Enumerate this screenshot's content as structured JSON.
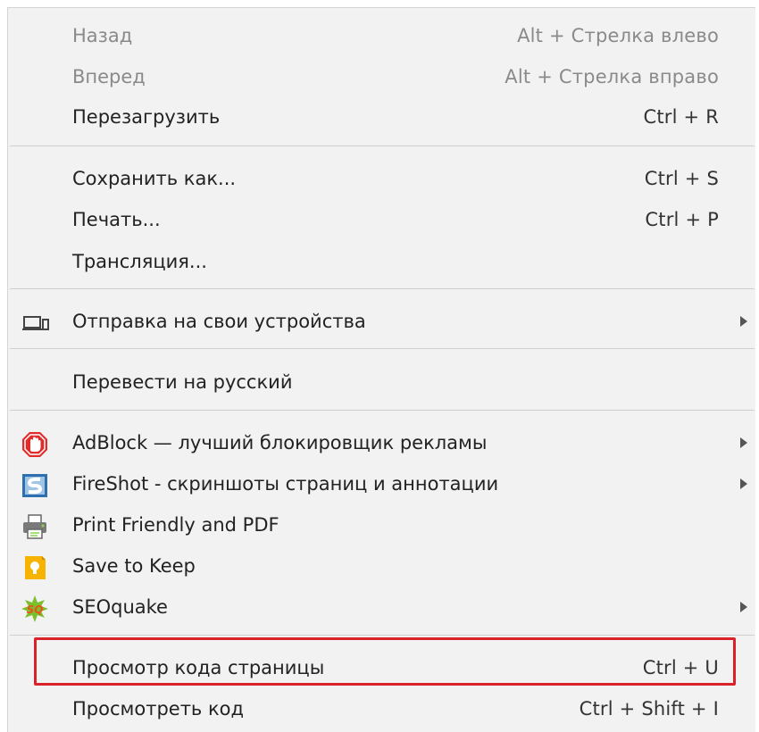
{
  "menu": {
    "nav": {
      "back": {
        "label": "Назад",
        "shortcut": "Alt + Стрелка влево"
      },
      "forward": {
        "label": "Вперед",
        "shortcut": "Alt + Стрелка вправо"
      },
      "reload": {
        "label": "Перезагрузить",
        "shortcut": "Ctrl + R"
      }
    },
    "file": {
      "save_as": {
        "label": "Сохранить как...",
        "shortcut": "Ctrl + S"
      },
      "print": {
        "label": "Печать...",
        "shortcut": "Ctrl + P"
      },
      "cast": {
        "label": "Трансляция..."
      }
    },
    "send": {
      "label": "Отправка на свои устройства",
      "icon": "devices-icon"
    },
    "translate": {
      "label": "Перевести на русский"
    },
    "extensions": {
      "adblock": {
        "label": "AdBlock — лучший блокировщик рекламы",
        "icon": "adblock-icon"
      },
      "fireshot": {
        "label": "FireShot - скриншоты страниц и аннотации",
        "icon": "fireshot-icon"
      },
      "printfriendly": {
        "label": "Print Friendly and PDF",
        "icon": "printer-icon"
      },
      "keep": {
        "label": "Save to Keep",
        "icon": "keep-icon"
      },
      "seoquake": {
        "label": "SEOquake",
        "icon": "seoquake-icon"
      }
    },
    "dev": {
      "view_source": {
        "label": "Просмотр кода страницы",
        "shortcut": "Ctrl + U"
      },
      "inspect": {
        "label": "Просмотреть код",
        "shortcut": "Ctrl + Shift + I"
      }
    }
  },
  "colors": {
    "highlight": "#d8232a",
    "menu_bg": "#f2f2f2"
  }
}
